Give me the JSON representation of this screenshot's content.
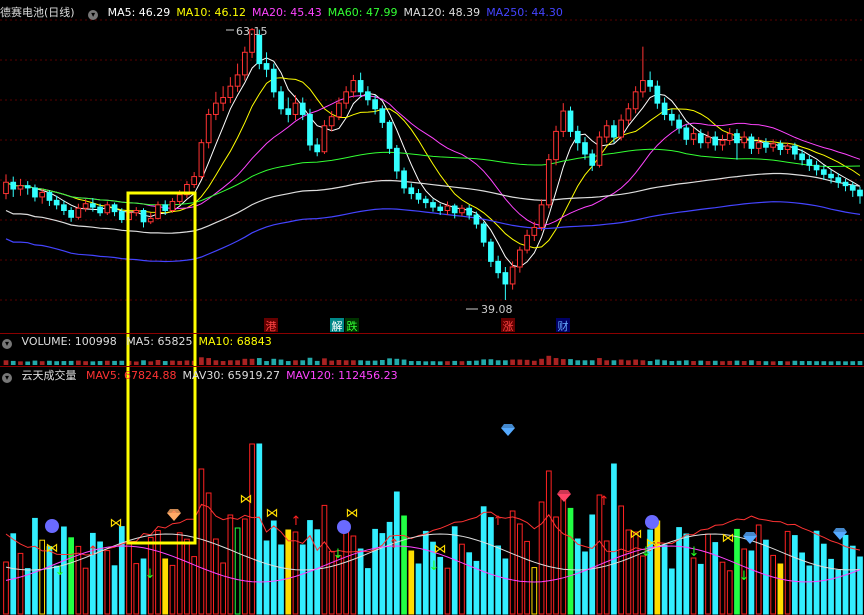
{
  "price_header": {
    "name": "德赛电池(日线)",
    "items": [
      {
        "label": "MA5: 46.29",
        "color": "#ffffff"
      },
      {
        "label": "MA10: 46.12",
        "color": "#ffff00"
      },
      {
        "label": "MA20: 45.43",
        "color": "#ff44ff"
      },
      {
        "label": "MA60: 47.99",
        "color": "#33ff33"
      },
      {
        "label": "MA120: 48.39",
        "color": "#dddddd"
      },
      {
        "label": "MA250: 44.30",
        "color": "#4444ff"
      }
    ]
  },
  "volume_header": {
    "name": "VOLUME: 100998",
    "items": [
      {
        "label": "MA5: 65825",
        "color": "#dddddd"
      },
      {
        "label": "MA10: 68843",
        "color": "#ffff00"
      }
    ]
  },
  "indicator_header": {
    "name": "云天成交量",
    "items": [
      {
        "label": "MAV5: 67824.88",
        "color": "#ff3333"
      },
      {
        "label": "MAV30: 65919.27",
        "color": "#dddddd"
      },
      {
        "label": "MAV120: 112456.23",
        "color": "#ff44ff"
      }
    ]
  },
  "event_labels": [
    {
      "text": "港",
      "color": "#ff4444",
      "bg": "#660000"
    },
    {
      "text": "解",
      "color": "#ffffff",
      "bg": "#008888"
    },
    {
      "text": "跌",
      "color": "#33ff33",
      "bg": "#003300"
    },
    {
      "text": "涨",
      "color": "#ff4444",
      "bg": "#660000"
    },
    {
      "text": "财",
      "color": "#66aaff",
      "bg": "#000066"
    }
  ],
  "chart_data": {
    "type": "candlestick",
    "annotations": {
      "high": "63.15",
      "low": "39.08"
    },
    "candles": [
      [
        48.5,
        49.5,
        50.2,
        48.0
      ],
      [
        49.5,
        48.9,
        50.0,
        48.2
      ],
      [
        48.9,
        49.2,
        49.8,
        48.3
      ],
      [
        49.2,
        49.0,
        49.6,
        48.4
      ],
      [
        49.0,
        48.2,
        49.3,
        47.8
      ],
      [
        48.2,
        48.6,
        48.9,
        47.6
      ],
      [
        48.6,
        47.9,
        48.8,
        47.4
      ],
      [
        47.9,
        47.5,
        48.3,
        47.1
      ],
      [
        47.5,
        47.0,
        47.9,
        46.6
      ],
      [
        47.0,
        46.4,
        47.3,
        46.0
      ],
      [
        46.4,
        47.2,
        47.6,
        46.2
      ],
      [
        47.2,
        47.6,
        48.0,
        46.9
      ],
      [
        47.6,
        47.3,
        48.1,
        46.9
      ],
      [
        47.3,
        46.8,
        47.6,
        46.5
      ],
      [
        46.8,
        47.5,
        47.8,
        46.6
      ],
      [
        47.5,
        46.9,
        47.7,
        46.5
      ],
      [
        46.9,
        46.2,
        47.2,
        45.9
      ],
      [
        46.2,
        46.8,
        47.1,
        46.0
      ],
      [
        46.8,
        47.0,
        47.3,
        46.5
      ],
      [
        47.0,
        46.0,
        47.2,
        45.5
      ],
      [
        46.0,
        46.3,
        46.8,
        45.8
      ],
      [
        46.3,
        47.5,
        47.8,
        46.2
      ],
      [
        47.5,
        47.0,
        47.9,
        46.6
      ],
      [
        47.0,
        47.8,
        48.1,
        46.8
      ],
      [
        47.8,
        48.4,
        48.8,
        47.5
      ],
      [
        48.4,
        49.3,
        49.6,
        48.1
      ],
      [
        49.3,
        50.0,
        50.4,
        49.0
      ],
      [
        50.0,
        53.0,
        53.3,
        49.8
      ],
      [
        53.0,
        55.5,
        56.0,
        52.5
      ],
      [
        55.5,
        56.5,
        57.5,
        55.0
      ],
      [
        56.5,
        57.0,
        58.0,
        55.8
      ],
      [
        57.0,
        58.0,
        58.8,
        56.5
      ],
      [
        58.0,
        59.0,
        60.0,
        57.5
      ],
      [
        59.0,
        61.0,
        61.5,
        58.5
      ],
      [
        61.0,
        63.0,
        63.15,
        60.5
      ],
      [
        62.5,
        60.0,
        63.0,
        59.5
      ],
      [
        60.0,
        59.5,
        61.0,
        58.8
      ],
      [
        59.5,
        57.5,
        60.0,
        57.0
      ],
      [
        57.5,
        56.0,
        58.0,
        55.5
      ],
      [
        56.0,
        55.5,
        57.0,
        54.8
      ],
      [
        55.5,
        56.5,
        57.2,
        55.0
      ],
      [
        56.5,
        55.5,
        57.0,
        55.0
      ],
      [
        55.5,
        52.8,
        56.0,
        52.3
      ],
      [
        52.8,
        52.2,
        53.4,
        51.8
      ],
      [
        52.2,
        54.5,
        55.0,
        52.0
      ],
      [
        54.5,
        55.3,
        55.8,
        54.0
      ],
      [
        55.3,
        56.5,
        57.0,
        55.0
      ],
      [
        56.5,
        57.5,
        58.0,
        56.0
      ],
      [
        57.5,
        58.5,
        59.0,
        57.0
      ],
      [
        58.5,
        57.5,
        59.2,
        57.0
      ],
      [
        57.5,
        56.8,
        58.0,
        56.3
      ],
      [
        56.8,
        56.0,
        57.2,
        55.5
      ],
      [
        56.0,
        54.8,
        56.3,
        54.3
      ],
      [
        54.8,
        52.5,
        55.0,
        52.0
      ],
      [
        52.5,
        50.5,
        52.8,
        49.8
      ],
      [
        50.5,
        49.0,
        50.8,
        48.5
      ],
      [
        49.0,
        48.5,
        49.4,
        48.0
      ],
      [
        48.5,
        48.0,
        48.9,
        47.6
      ],
      [
        48.0,
        47.7,
        48.3,
        47.2
      ],
      [
        47.7,
        47.3,
        48.0,
        46.9
      ],
      [
        47.3,
        47.0,
        47.6,
        46.6
      ],
      [
        47.0,
        47.4,
        47.8,
        46.6
      ],
      [
        47.4,
        46.8,
        47.6,
        46.3
      ],
      [
        46.8,
        47.2,
        47.5,
        46.5
      ],
      [
        47.2,
        46.6,
        47.5,
        46.2
      ],
      [
        46.6,
        45.8,
        46.9,
        45.4
      ],
      [
        45.8,
        44.2,
        46.0,
        43.8
      ],
      [
        44.2,
        42.5,
        44.5,
        42.0
      ],
      [
        42.5,
        41.5,
        43.0,
        41.0
      ],
      [
        41.5,
        40.5,
        42.0,
        39.08
      ],
      [
        40.5,
        42.0,
        42.5,
        40.0
      ],
      [
        42.0,
        43.5,
        43.8,
        41.5
      ],
      [
        43.5,
        44.8,
        45.3,
        43.2
      ],
      [
        44.8,
        45.5,
        46.0,
        44.3
      ],
      [
        45.5,
        47.5,
        48.0,
        45.2
      ],
      [
        47.5,
        51.5,
        52.0,
        47.2
      ],
      [
        51.5,
        54.0,
        54.5,
        51.0
      ],
      [
        54.0,
        55.8,
        56.5,
        53.5
      ],
      [
        55.8,
        54.0,
        56.2,
        53.5
      ],
      [
        54.0,
        53.0,
        54.5,
        52.3
      ],
      [
        53.0,
        52.0,
        53.5,
        51.5
      ],
      [
        52.0,
        51.0,
        52.4,
        50.5
      ],
      [
        51.0,
        53.5,
        54.0,
        50.8
      ],
      [
        53.5,
        54.5,
        55.0,
        53.0
      ],
      [
        54.5,
        53.5,
        55.0,
        53.0
      ],
      [
        53.5,
        55.0,
        55.5,
        53.2
      ],
      [
        55.0,
        56.0,
        56.5,
        54.6
      ],
      [
        56.0,
        57.5,
        58.0,
        55.6
      ],
      [
        57.5,
        58.5,
        61.5,
        57.0
      ],
      [
        58.5,
        58.0,
        59.3,
        57.5
      ],
      [
        58.0,
        56.5,
        58.5,
        56.0
      ],
      [
        56.5,
        55.5,
        57.0,
        55.0
      ],
      [
        55.5,
        55.0,
        56.0,
        54.5
      ],
      [
        55.0,
        54.3,
        55.5,
        53.8
      ],
      [
        54.3,
        53.3,
        54.6,
        52.8
      ],
      [
        53.3,
        53.8,
        54.3,
        52.8
      ],
      [
        53.8,
        53.0,
        54.2,
        52.5
      ],
      [
        53.0,
        53.5,
        54.0,
        52.5
      ],
      [
        53.5,
        52.8,
        54.0,
        52.3
      ],
      [
        52.8,
        53.2,
        53.7,
        52.3
      ],
      [
        53.2,
        53.8,
        54.3,
        52.8
      ],
      [
        53.8,
        53.0,
        54.2,
        51.5
      ],
      [
        53.0,
        53.5,
        54.0,
        52.5
      ],
      [
        53.5,
        52.5,
        53.8,
        52.0
      ],
      [
        52.5,
        53.0,
        53.5,
        52.0
      ],
      [
        53.0,
        52.6,
        53.4,
        52.1
      ],
      [
        52.6,
        52.9,
        53.3,
        52.2
      ],
      [
        52.9,
        52.4,
        53.2,
        51.9
      ],
      [
        52.4,
        52.7,
        53.0,
        52.0
      ],
      [
        52.7,
        52.0,
        53.0,
        51.5
      ],
      [
        52.0,
        51.5,
        52.4,
        51.0
      ],
      [
        51.5,
        51.0,
        51.9,
        50.5
      ],
      [
        51.0,
        50.6,
        51.4,
        50.1
      ],
      [
        50.6,
        50.2,
        51.0,
        49.7
      ],
      [
        50.2,
        49.9,
        50.6,
        49.4
      ],
      [
        49.9,
        49.5,
        50.3,
        49.0
      ],
      [
        49.5,
        49.2,
        49.8,
        48.7
      ],
      [
        49.2,
        48.8,
        49.5,
        48.2
      ],
      [
        48.8,
        48.3,
        49.1,
        47.6
      ]
    ]
  }
}
